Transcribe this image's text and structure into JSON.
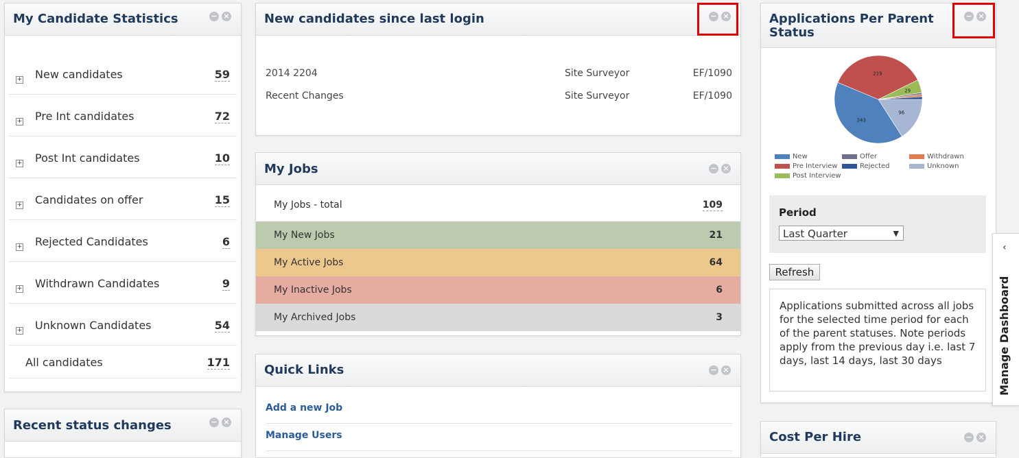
{
  "candidate_stats": {
    "title": "My Candidate Statistics",
    "rows": [
      {
        "label": "New candidates",
        "count": "59"
      },
      {
        "label": "Pre Int candidates",
        "count": "72"
      },
      {
        "label": "Post Int candidates",
        "count": "10"
      },
      {
        "label": "Candidates on offer",
        "count": "15"
      },
      {
        "label": "Rejected Candidates",
        "count": "6"
      },
      {
        "label": "Withdrawn Candidates",
        "count": "9"
      },
      {
        "label": "Unknown Candidates",
        "count": "54"
      }
    ],
    "total": {
      "label": "All candidates",
      "count": "171"
    }
  },
  "recent_status": {
    "title": "Recent status changes"
  },
  "new_candidates": {
    "title": "New candidates since last login",
    "rows": [
      {
        "name": "2014 2204",
        "job": "Site Surveyor",
        "ref": "EF/1090"
      },
      {
        "name": "Recent Changes",
        "job": "Site Surveyor",
        "ref": "EF/1090"
      }
    ]
  },
  "my_jobs": {
    "title": "My Jobs",
    "total": {
      "label": "My Jobs - total",
      "count": "109"
    },
    "rows": [
      {
        "label": "My New Jobs",
        "count": "21",
        "color": "#bccbad"
      },
      {
        "label": "My Active Jobs",
        "count": "64",
        "color": "#ecc88c"
      },
      {
        "label": "My Inactive Jobs",
        "count": "6",
        "color": "#e6aca2"
      },
      {
        "label": "My Archived Jobs",
        "count": "3",
        "color": "#dadada"
      }
    ]
  },
  "quick_links": {
    "title": "Quick Links",
    "links": [
      "Add a new Job",
      "Manage Users"
    ]
  },
  "applications": {
    "title_line1": "Applications Per Parent",
    "title_line2": "Status",
    "period_label": "Period",
    "period_selected": "Last Quarter",
    "refresh_label": "Refresh",
    "description": "Applications submitted across all jobs for the selected time period for each of the parent statuses. Note periods apply from the previous day i.e. last 7 days, last 14 days, last 30 days"
  },
  "chart_data": {
    "type": "pie",
    "series": [
      {
        "name": "New",
        "value": 243,
        "color": "#4f81bd"
      },
      {
        "name": "Pre Interview",
        "value": 219,
        "color": "#c0504d"
      },
      {
        "name": "Post Interview",
        "value": 29,
        "color": "#9bbb59"
      },
      {
        "name": "Offer",
        "value": 4,
        "color": "#6e6e8e"
      },
      {
        "name": "Withdrawn",
        "value": 5,
        "color": "#e07b53"
      },
      {
        "name": "Rejected",
        "value": 6,
        "color": "#2f5597"
      },
      {
        "name": "Unknown",
        "value": 96,
        "color": "#a7b6d2"
      }
    ],
    "slice_labels": [
      "243",
      "219",
      "29",
      "96"
    ],
    "legend": [
      "New",
      "Offer",
      "Withdrawn",
      "Pre Interview",
      "Rejected",
      "Unknown",
      "Post Interview"
    ]
  },
  "cost_per_hire": {
    "title": "Cost Per Hire"
  },
  "side_tab": {
    "label": "Manage Dashboard",
    "arrow": "‹"
  },
  "controls": {
    "minimize": "−",
    "close": "×"
  }
}
